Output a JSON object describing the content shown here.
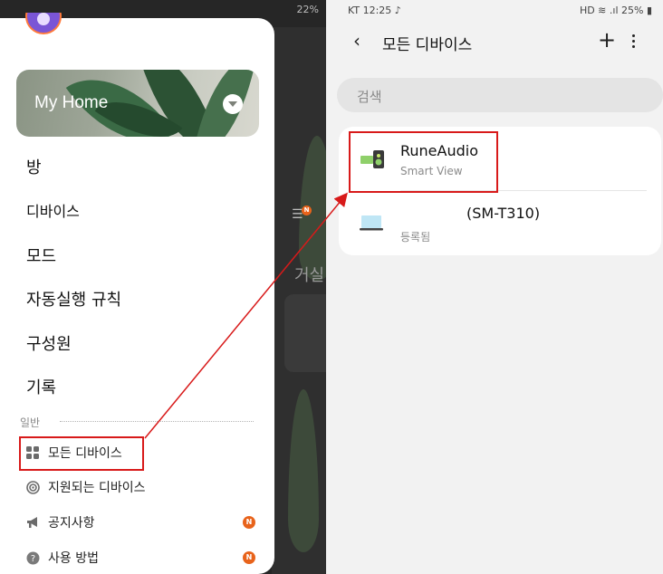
{
  "left": {
    "status": {
      "battery": "22%"
    },
    "home": {
      "title": "My Home"
    },
    "menu": [
      {
        "label": "방"
      },
      {
        "label": "디바이스"
      },
      {
        "label": "모드"
      },
      {
        "label": "자동실행 규칙"
      },
      {
        "label": "구성원"
      },
      {
        "label": "기록"
      }
    ],
    "section_label": "일반",
    "sub_menu": [
      {
        "label": "모든 디바이스",
        "icon": "devices-icon"
      },
      {
        "label": "지원되는 디바이스",
        "icon": "supported-devices-icon"
      },
      {
        "label": "공지사항",
        "icon": "megaphone-icon",
        "badge": "N"
      },
      {
        "label": "사용 방법",
        "icon": "help-icon",
        "badge": "N"
      }
    ],
    "background": {
      "room": "거실",
      "badge": "N"
    }
  },
  "right": {
    "status": {
      "left": "KT 12:25 ♪",
      "right": "HD ≋ .ıl 25% ▮"
    },
    "title": "모든 디바이스",
    "search_placeholder": "검색",
    "devices": [
      {
        "name": "RuneAudio",
        "subtitle": "Smart View",
        "icon": "speaker-tv-icon"
      },
      {
        "name": "(SM-T310)",
        "subtitle": "등록됨",
        "icon": "laptop-icon"
      }
    ]
  },
  "colors": {
    "highlight": "#d81a1a",
    "badge": "#e8631b",
    "avatar": "#7a55d6"
  }
}
